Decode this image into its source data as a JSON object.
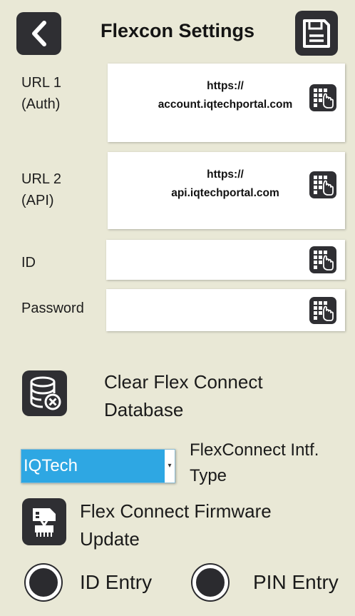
{
  "header": {
    "title": "Flexcon Settings",
    "back_icon": "chevron-left-icon",
    "save_icon": "floppy-disk-icon"
  },
  "url1": {
    "label_line1": "URL 1",
    "label_line2": "(Auth)",
    "value_line1": "https://",
    "value_line2": "account.iqtechportal.com"
  },
  "url2": {
    "label_line1": "URL 2",
    "label_line2": "(API)",
    "value_line1": "https://",
    "value_line2": "api.iqtechportal.com"
  },
  "id_field": {
    "label": "ID",
    "value": ""
  },
  "password_field": {
    "label": "Password",
    "value": ""
  },
  "clear_db": {
    "line1": "Clear Flex Connect",
    "line2": "Database"
  },
  "interface_type": {
    "selected": "IQTech",
    "label_line1": "FlexConnect Intf.",
    "label_line2": "Type"
  },
  "firmware": {
    "line1": "Flex Connect Firmware",
    "line2": "Update"
  },
  "entry_mode": {
    "id_label": "ID Entry",
    "pin_label": "PIN Entry"
  },
  "colors": {
    "background": "#e9e8d6",
    "dark": "#2f2f33",
    "select_blue": "#2ea7e3"
  }
}
